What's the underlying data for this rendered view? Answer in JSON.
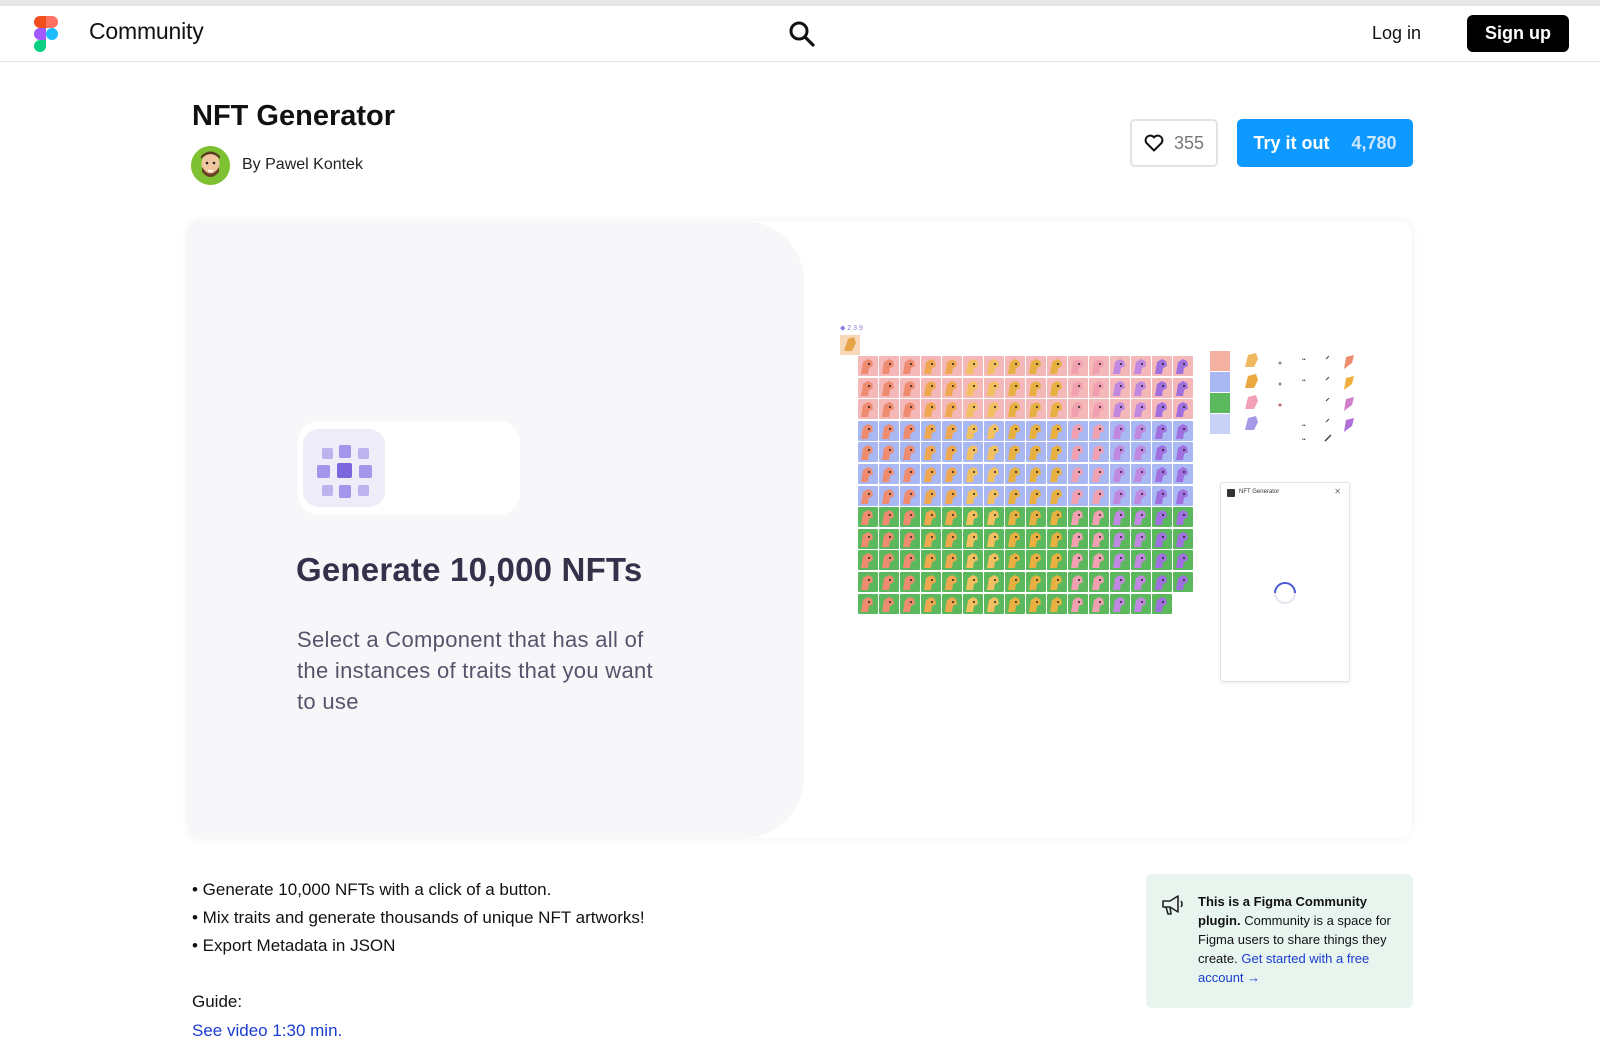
{
  "header": {
    "brand": "Community",
    "login_label": "Log in",
    "signup_label": "Sign up"
  },
  "plugin": {
    "title": "NFT Generator",
    "author": "By Pawel Kontek",
    "likes": "355",
    "try_label": "Try it out",
    "try_count": "4,780"
  },
  "hero": {
    "heading": "Generate 10,000 NFTs",
    "subtitle": "Select a Component that has all of the instances of traits that you want to use",
    "window_title": "NFT Generator",
    "close_glyph": "✕"
  },
  "description": {
    "bullets": [
      "• Generate 10,000 NFTs with a click of a button.",
      "• Mix traits and generate thousands of unique NFT artworks!",
      "• Export Metadata in JSON"
    ],
    "guide_label": "Guide:",
    "video_link": "See video 1:30 min."
  },
  "callout": {
    "bold": "This is a Figma Community plugin.",
    "text": " Community is a space for Figma users to share things they create. ",
    "link": "Get started with a free account →"
  },
  "colors": {
    "accent": "#0d99ff",
    "row_pink": "#f4b8b8",
    "row_blue": "#a9b8f2",
    "row_green": "#5cb85c"
  },
  "icons": {
    "logo": "figma-logo-icon",
    "search": "search-icon",
    "like": "heart-icon",
    "callout": "megaphone-icon"
  }
}
